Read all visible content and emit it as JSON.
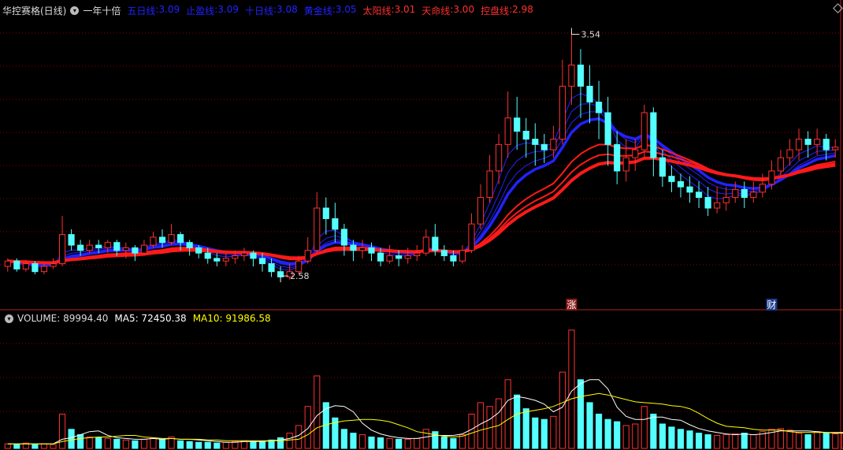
{
  "header": {
    "stock_title": "华控赛格(日线)",
    "indicator_name": "一年十倍",
    "lines": [
      {
        "name": "五日线",
        "value": "3.09",
        "color": "#2222ff"
      },
      {
        "name": "止盈线",
        "value": "3.09",
        "color": "#2222ff"
      },
      {
        "name": "十日线",
        "value": "3.08",
        "color": "#2222ff"
      },
      {
        "name": "黄金线",
        "value": "3.05",
        "color": "#2222ff"
      },
      {
        "name": "太阳线",
        "value": "3.01",
        "color": "#ff3030"
      },
      {
        "name": "天命线",
        "value": "3.00",
        "color": "#ff3030"
      },
      {
        "name": "控盘线",
        "value": "2.98",
        "color": "#ff3030"
      }
    ]
  },
  "volume_header": {
    "volume_label": "VOLUME: 89994.40",
    "ma5_label": "MA5: 72450.38",
    "ma10_label": "MA10: 91986.58",
    "ma5_color": "#ffffff",
    "ma10_color": "#ffff00"
  },
  "markers": {
    "zhang": "涨",
    "cai": "财",
    "high_label": "3.54",
    "low_label": "2.58"
  },
  "colors": {
    "up": "#ff3030",
    "down": "#54ffff",
    "grid": "#8b0000",
    "ma_blue": "#2222ff",
    "ma_red": "#ff1a1a"
  },
  "chart_data": [
    {
      "type": "candlestick",
      "title": "华控赛格(日线)",
      "ylim": [
        2.5,
        3.58
      ],
      "annotations": [
        {
          "text": "3.54",
          "x": 62,
          "y": 3.54
        },
        {
          "text": "2.58",
          "x": 30,
          "y": 2.58
        }
      ],
      "candles": [
        [
          2.64,
          2.66,
          2.62,
          2.67
        ],
        [
          2.66,
          2.63,
          2.62,
          2.67
        ],
        [
          2.63,
          2.65,
          2.62,
          2.66
        ],
        [
          2.65,
          2.62,
          2.61,
          2.66
        ],
        [
          2.62,
          2.64,
          2.61,
          2.65
        ],
        [
          2.64,
          2.65,
          2.63,
          2.67
        ],
        [
          2.65,
          2.76,
          2.64,
          2.83
        ],
        [
          2.76,
          2.72,
          2.7,
          2.78
        ],
        [
          2.72,
          2.7,
          2.68,
          2.74
        ],
        [
          2.7,
          2.72,
          2.69,
          2.74
        ],
        [
          2.72,
          2.71,
          2.69,
          2.74
        ],
        [
          2.71,
          2.73,
          2.69,
          2.74
        ],
        [
          2.73,
          2.7,
          2.68,
          2.74
        ],
        [
          2.7,
          2.71,
          2.67,
          2.73
        ],
        [
          2.71,
          2.69,
          2.66,
          2.72
        ],
        [
          2.69,
          2.72,
          2.68,
          2.74
        ],
        [
          2.72,
          2.75,
          2.71,
          2.77
        ],
        [
          2.75,
          2.73,
          2.71,
          2.78
        ],
        [
          2.73,
          2.76,
          2.72,
          2.8
        ],
        [
          2.76,
          2.73,
          2.7,
          2.77
        ],
        [
          2.73,
          2.71,
          2.68,
          2.74
        ],
        [
          2.71,
          2.69,
          2.67,
          2.72
        ],
        [
          2.69,
          2.67,
          2.65,
          2.71
        ],
        [
          2.67,
          2.66,
          2.64,
          2.69
        ],
        [
          2.66,
          2.67,
          2.64,
          2.69
        ],
        [
          2.67,
          2.68,
          2.65,
          2.7
        ],
        [
          2.68,
          2.69,
          2.66,
          2.71
        ],
        [
          2.69,
          2.67,
          2.64,
          2.7
        ],
        [
          2.67,
          2.65,
          2.62,
          2.69
        ],
        [
          2.65,
          2.62,
          2.6,
          2.67
        ],
        [
          2.62,
          2.6,
          2.58,
          2.64
        ],
        [
          2.6,
          2.62,
          2.59,
          2.65
        ],
        [
          2.62,
          2.66,
          2.61,
          2.68
        ],
        [
          2.66,
          2.7,
          2.65,
          2.75
        ],
        [
          2.7,
          2.86,
          2.69,
          2.92
        ],
        [
          2.86,
          2.82,
          2.76,
          2.9
        ],
        [
          2.82,
          2.78,
          2.73,
          2.88
        ],
        [
          2.78,
          2.72,
          2.68,
          2.8
        ],
        [
          2.72,
          2.7,
          2.66,
          2.74
        ],
        [
          2.7,
          2.71,
          2.67,
          2.74
        ],
        [
          2.71,
          2.69,
          2.66,
          2.73
        ],
        [
          2.69,
          2.66,
          2.64,
          2.71
        ],
        [
          2.66,
          2.68,
          2.65,
          2.72
        ],
        [
          2.68,
          2.67,
          2.64,
          2.7
        ],
        [
          2.67,
          2.68,
          2.65,
          2.71
        ],
        [
          2.68,
          2.69,
          2.66,
          2.72
        ],
        [
          2.69,
          2.75,
          2.68,
          2.78
        ],
        [
          2.75,
          2.7,
          2.68,
          2.8
        ],
        [
          2.7,
          2.68,
          2.66,
          2.72
        ],
        [
          2.68,
          2.66,
          2.64,
          2.7
        ],
        [
          2.66,
          2.7,
          2.65,
          2.72
        ],
        [
          2.7,
          2.8,
          2.69,
          2.84
        ],
        [
          2.8,
          2.9,
          2.78,
          2.95
        ],
        [
          2.9,
          3.0,
          2.88,
          3.06
        ],
        [
          3.0,
          3.1,
          2.95,
          3.14
        ],
        [
          3.1,
          3.2,
          3.05,
          3.3
        ],
        [
          3.2,
          3.15,
          3.08,
          3.28
        ],
        [
          3.15,
          3.12,
          3.05,
          3.2
        ],
        [
          3.12,
          3.1,
          3.02,
          3.18
        ],
        [
          3.1,
          3.08,
          3.03,
          3.14
        ],
        [
          3.08,
          3.12,
          3.05,
          3.17
        ],
        [
          3.12,
          3.32,
          3.1,
          3.42
        ],
        [
          3.32,
          3.4,
          3.25,
          3.54
        ],
        [
          3.4,
          3.32,
          3.2,
          3.46
        ],
        [
          3.32,
          3.26,
          3.18,
          3.4
        ],
        [
          3.26,
          3.22,
          3.12,
          3.34
        ],
        [
          3.22,
          3.1,
          3.02,
          3.28
        ],
        [
          3.1,
          3.0,
          2.95,
          3.15
        ],
        [
          3.0,
          3.05,
          2.96,
          3.12
        ],
        [
          3.05,
          3.08,
          3.0,
          3.12
        ],
        [
          3.08,
          3.22,
          3.05,
          3.25
        ],
        [
          3.22,
          3.05,
          2.98,
          3.24
        ],
        [
          3.05,
          2.98,
          2.94,
          3.08
        ],
        [
          2.98,
          2.96,
          2.92,
          3.02
        ],
        [
          2.96,
          2.94,
          2.9,
          2.99
        ],
        [
          2.94,
          2.92,
          2.88,
          2.98
        ],
        [
          2.92,
          2.9,
          2.86,
          2.96
        ],
        [
          2.9,
          2.86,
          2.83,
          2.94
        ],
        [
          2.86,
          2.88,
          2.84,
          2.94
        ],
        [
          2.88,
          2.9,
          2.85,
          2.94
        ],
        [
          2.9,
          2.93,
          2.88,
          2.96
        ],
        [
          2.93,
          2.9,
          2.86,
          2.96
        ],
        [
          2.9,
          2.92,
          2.88,
          2.96
        ],
        [
          2.92,
          2.95,
          2.9,
          2.99
        ],
        [
          2.95,
          3.0,
          2.93,
          3.04
        ],
        [
          3.0,
          3.05,
          2.98,
          3.08
        ],
        [
          3.05,
          3.08,
          3.02,
          3.12
        ],
        [
          3.08,
          3.12,
          3.04,
          3.16
        ],
        [
          3.12,
          3.1,
          3.05,
          3.15
        ],
        [
          3.1,
          3.12,
          3.06,
          3.16
        ],
        [
          3.12,
          3.08,
          3.04,
          3.14
        ],
        [
          3.08,
          3.09,
          3.05,
          3.12
        ]
      ],
      "series": [
        {
          "name": "五日线"
        },
        {
          "name": "止盈线"
        },
        {
          "name": "十日线"
        },
        {
          "name": "黄金线"
        },
        {
          "name": "太阳线"
        },
        {
          "name": "天命线"
        },
        {
          "name": "控盘线"
        }
      ]
    },
    {
      "type": "bar",
      "title": "VOLUME",
      "ylim": [
        0,
        160000
      ],
      "values": [
        6000,
        5000,
        7000,
        5000,
        6000,
        5000,
        45000,
        25000,
        18000,
        15000,
        14000,
        13000,
        12000,
        11000,
        10000,
        12000,
        14000,
        12000,
        15000,
        10000,
        9000,
        8000,
        8000,
        7000,
        8000,
        9000,
        10000,
        9000,
        9000,
        11000,
        14000,
        20000,
        30000,
        55000,
        95000,
        60000,
        40000,
        25000,
        20000,
        18000,
        15000,
        14000,
        13000,
        12000,
        12000,
        13000,
        25000,
        22000,
        15000,
        13000,
        18000,
        45000,
        60000,
        55000,
        65000,
        90000,
        70000,
        52000,
        40000,
        38000,
        42000,
        100000,
        155000,
        90000,
        60000,
        45000,
        38000,
        35000,
        30000,
        32000,
        55000,
        45000,
        32000,
        28000,
        25000,
        23000,
        20000,
        18000,
        17000,
        18000,
        19000,
        20000,
        18000,
        22000,
        25000,
        26000,
        24000,
        20000,
        18000,
        22000,
        20000,
        19000,
        21000,
        17000,
        14000
      ],
      "series": [
        {
          "name": "MA5",
          "values": [
            6000,
            6000,
            6000,
            6000,
            6000,
            6000,
            12000,
            14000,
            18000,
            22000,
            23000,
            17000,
            14000,
            13000,
            12000,
            12000,
            13000,
            12000,
            13000,
            12000,
            12000,
            11000,
            10000,
            9000,
            8000,
            8000,
            9000,
            9000,
            9000,
            10000,
            11000,
            13000,
            17000,
            26000,
            43000,
            52000,
            56000,
            55000,
            48000,
            33000,
            24000,
            19000,
            16000,
            14000,
            13000,
            13000,
            15000,
            17000,
            17000,
            17000,
            19000,
            25000,
            32000,
            38000,
            47000,
            63000,
            68000,
            66000,
            63000,
            58000,
            48000,
            54000,
            75000,
            85000,
            90000,
            90000,
            78000,
            54000,
            42000,
            38000,
            38000,
            41000,
            41000,
            38000,
            37000,
            31000,
            26000,
            23000,
            21000,
            19000,
            18000,
            19000,
            18000,
            19000,
            21000,
            23000,
            23000,
            23000,
            23000,
            22000,
            21000,
            20000,
            20000,
            19000,
            18000
          ]
        },
        {
          "name": "MA10",
          "values": [
            6000,
            6000,
            6000,
            6000,
            6000,
            6000,
            9000,
            11000,
            13000,
            14000,
            15000,
            15000,
            16000,
            17000,
            17000,
            15000,
            14000,
            13000,
            13000,
            12000,
            12000,
            12000,
            11000,
            11000,
            10000,
            10000,
            10000,
            10000,
            10000,
            10000,
            10000,
            11000,
            12000,
            18000,
            27000,
            31000,
            34000,
            36000,
            37000,
            38000,
            38000,
            37000,
            35000,
            31000,
            27000,
            22000,
            20000,
            18000,
            16000,
            15000,
            16000,
            20000,
            24000,
            27000,
            30000,
            38000,
            45000,
            48000,
            50000,
            52000,
            55000,
            60000,
            65000,
            68000,
            70000,
            72000,
            70000,
            67000,
            64000,
            61000,
            60000,
            59000,
            58000,
            56000,
            55000,
            52000,
            46000,
            39000,
            33000,
            29000,
            28000,
            27000,
            25000,
            24000,
            24000,
            24000,
            22000,
            21000,
            21000,
            21000,
            21000,
            21000,
            21000,
            21000,
            20000
          ]
        }
      ]
    }
  ]
}
